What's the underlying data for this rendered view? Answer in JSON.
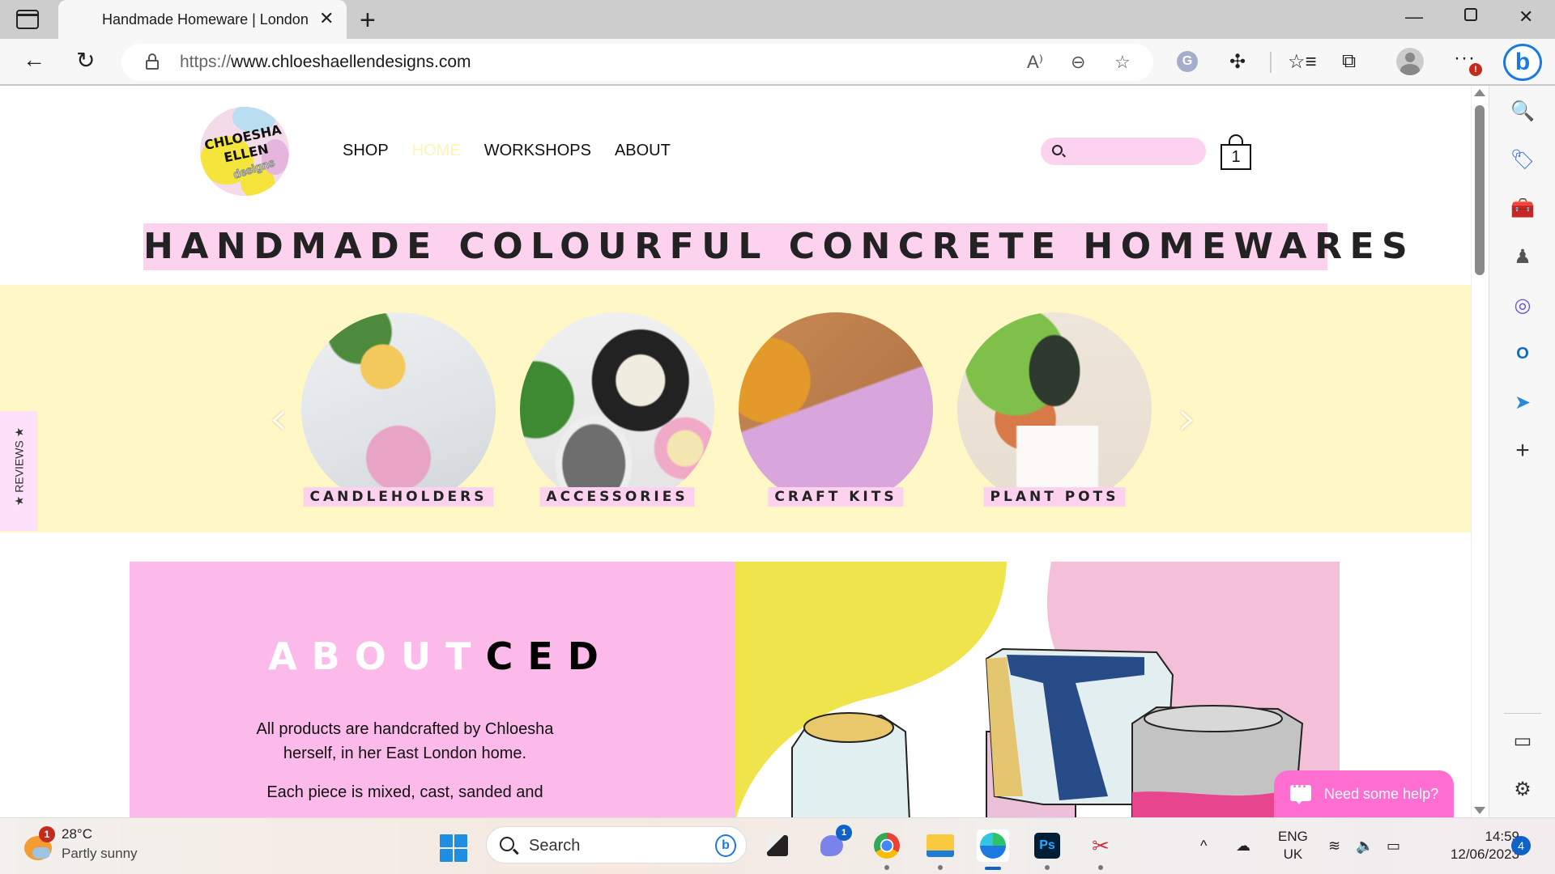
{
  "browser": {
    "tab_title": "Handmade Homeware | London",
    "url_protocol": "https://",
    "url_host": "www.chloeshaellendesigns.com",
    "more_badge": "!",
    "accent": "#1b7ae0"
  },
  "site": {
    "logo": {
      "line1": "CHLOESHA",
      "line2": "ELLEN",
      "line3": "designs"
    },
    "nav": [
      {
        "label": "SHOP",
        "active": false
      },
      {
        "label": "HOME",
        "active": true
      },
      {
        "label": "WORKSHOPS",
        "active": false
      },
      {
        "label": "ABOUT",
        "active": false
      }
    ],
    "search_placeholder": "",
    "cart_count": "1",
    "hero_title": "HANDMADE COLOURFUL CONCRETE HOMEWARES",
    "categories": [
      {
        "label": "CANDLEHOLDERS"
      },
      {
        "label": "ACCESSORIES"
      },
      {
        "label": "CRAFT KITS"
      },
      {
        "label": "PLANT POTS"
      }
    ],
    "reviews_label": "REVIEWS",
    "about": {
      "heading_white": "ABOUT",
      "heading_black": "CED",
      "paragraph1": "All products are handcrafted by Chloesha herself, in her East London home.",
      "paragraph2": "Each piece is mixed, cast, sanded and"
    },
    "help_label": "Need some help?",
    "colors": {
      "pink": "#fdd2ee",
      "yellow_band": "#fff8c6",
      "about_pink": "#fbbaea",
      "help_pink": "#ff6ed0"
    }
  },
  "taskbar": {
    "weather_temp": "28°C",
    "weather_desc": "Partly sunny",
    "weather_badge": "1",
    "search_label": "Search",
    "teams_badge": "1",
    "lang_line1": "ENG",
    "lang_line2": "UK",
    "time": "14:59",
    "date": "12/06/2023",
    "notifications": "4"
  }
}
